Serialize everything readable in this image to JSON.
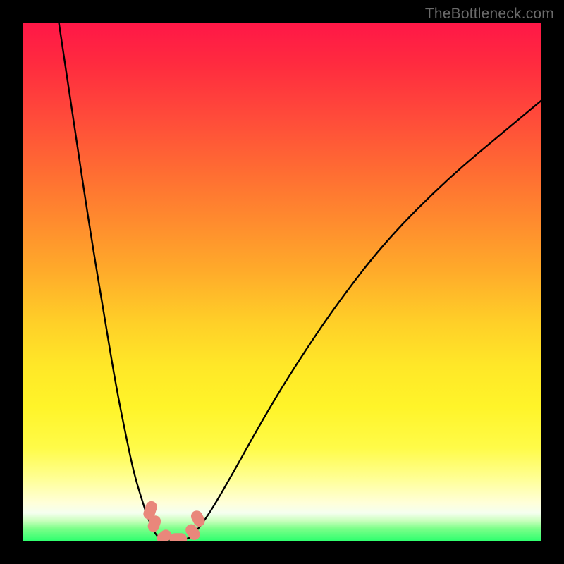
{
  "watermark": "TheBottleneck.com",
  "colors": {
    "page_bg": "#000000",
    "curve": "#000000",
    "marker": "#e9877b"
  },
  "chart_data": {
    "type": "line",
    "title": "",
    "xlabel": "",
    "ylabel": "",
    "xlim": [
      0,
      100
    ],
    "ylim": [
      0,
      100
    ],
    "note": "Bottleneck-style V-curve. Values are percent (0–100) in plot coordinates, y=0 at bottom. Estimated from pixels; no numeric axis labels are present in the image.",
    "series": [
      {
        "name": "left-branch",
        "x": [
          7,
          10,
          13,
          16,
          18,
          20,
          21.5,
          23,
          24,
          25,
          25.8,
          26.5
        ],
        "y": [
          100,
          80,
          60,
          42,
          30,
          20,
          13,
          8,
          5,
          2.5,
          1.2,
          0.5
        ]
      },
      {
        "name": "valley",
        "x": [
          26.5,
          28,
          30,
          32
        ],
        "y": [
          0.5,
          0.3,
          0.3,
          0.6
        ]
      },
      {
        "name": "right-branch",
        "x": [
          32,
          34,
          37,
          41,
          46,
          52,
          60,
          70,
          82,
          94,
          100
        ],
        "y": [
          0.6,
          2.5,
          7,
          14,
          23,
          33,
          45,
          58,
          70,
          80,
          85
        ]
      }
    ],
    "markers": [
      {
        "shape": "capsule",
        "cx": 24.6,
        "cy": 6.0,
        "angle": -72,
        "len": 3.6,
        "w": 2.2
      },
      {
        "shape": "capsule",
        "cx": 25.4,
        "cy": 3.4,
        "angle": -72,
        "len": 3.2,
        "w": 2.2
      },
      {
        "shape": "capsule",
        "cx": 27.3,
        "cy": 0.9,
        "angle": -40,
        "len": 3.0,
        "w": 2.2
      },
      {
        "shape": "capsule",
        "cx": 30.0,
        "cy": 0.5,
        "angle": 0,
        "len": 3.4,
        "w": 2.2
      },
      {
        "shape": "capsule",
        "cx": 32.8,
        "cy": 1.8,
        "angle": 55,
        "len": 3.2,
        "w": 2.2
      },
      {
        "shape": "capsule",
        "cx": 33.8,
        "cy": 4.4,
        "angle": 62,
        "len": 3.2,
        "w": 2.2
      }
    ]
  }
}
